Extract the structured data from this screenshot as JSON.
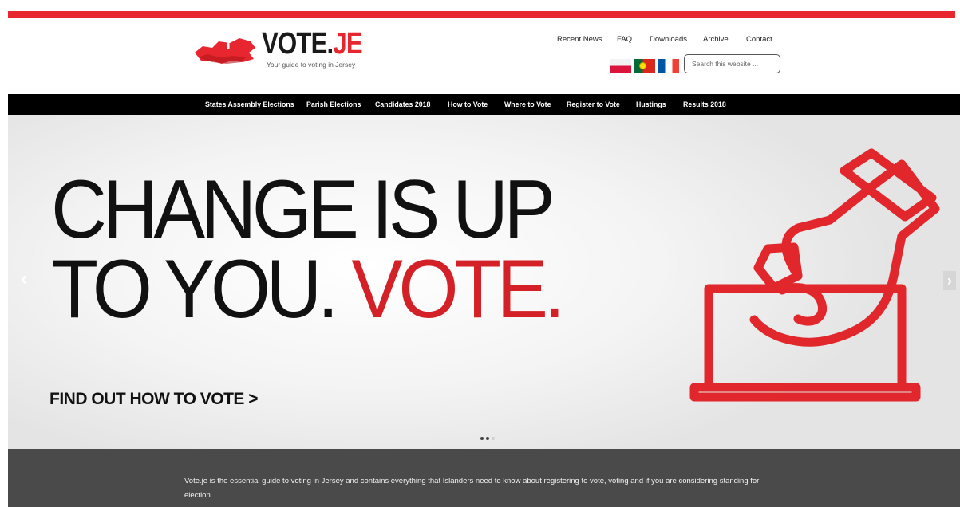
{
  "brand": {
    "name_part1": "VOTE.",
    "name_part2": "JE",
    "tagline": "Your guide to voting in Jersey",
    "accent_color": "#e8262f"
  },
  "top_nav": {
    "items": [
      {
        "label": "Recent News"
      },
      {
        "label": "FAQ"
      },
      {
        "label": "Downloads"
      },
      {
        "label": "Archive"
      },
      {
        "label": "Contact"
      }
    ]
  },
  "language_flags": [
    {
      "name": "polish-flag-icon"
    },
    {
      "name": "portuguese-flag-icon"
    },
    {
      "name": "french-flag-icon"
    }
  ],
  "search": {
    "placeholder": "Search this website ...",
    "value": ""
  },
  "main_nav": {
    "items": [
      {
        "label": "States Assembly Elections"
      },
      {
        "label": "Parish Elections"
      },
      {
        "label": "Candidates 2018"
      },
      {
        "label": "How to Vote"
      },
      {
        "label": "Where to Vote"
      },
      {
        "label": "Register to Vote"
      },
      {
        "label": "Hustings"
      },
      {
        "label": "Results 2018"
      }
    ]
  },
  "hero": {
    "line1": "CHANGE IS UP",
    "line2_black": "TO YOU.",
    "line2_red": " VOTE.",
    "cta": "FIND OUT HOW TO VOTE >",
    "illustration": "hand-casting-ballot-icon",
    "slides_total": 3,
    "active_slide": 2,
    "prev_arrow": "‹",
    "next_arrow": "›"
  },
  "intro_text": "Vote.je is the essential guide to voting in Jersey and contains everything that Islanders need to know about registering to vote, voting and if you are considering standing for election."
}
